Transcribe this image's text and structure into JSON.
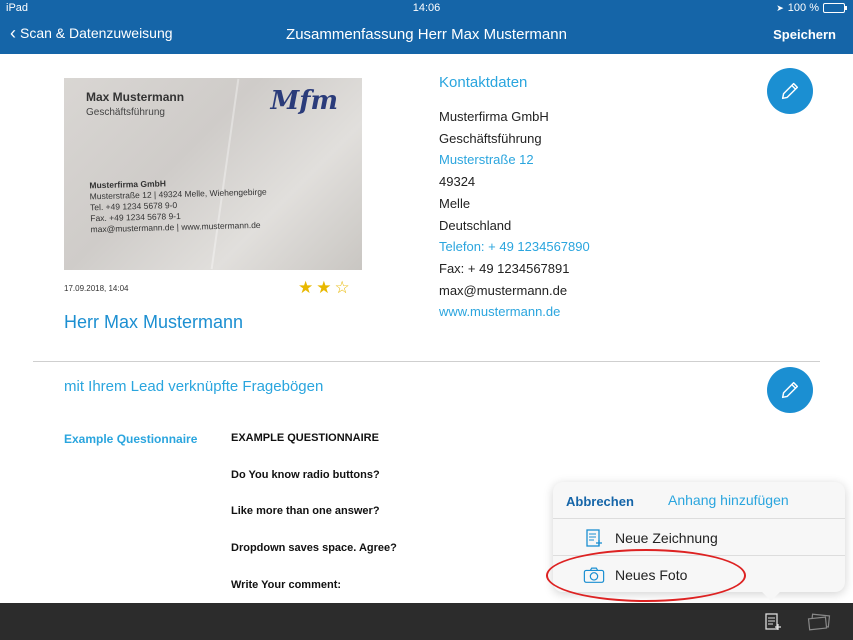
{
  "status": {
    "device": "iPad",
    "time": "14:06",
    "battery": "100 %"
  },
  "nav": {
    "back_label": "Scan & Datenzuweisung",
    "title": "Zusammenfassung Herr Max Mustermann",
    "save_label": "Speichern"
  },
  "card": {
    "name": "Max Mustermann",
    "role": "Geschäftsführung",
    "logo": "Mfm",
    "company": "Musterfirma GmbH",
    "address": "Musterstraße 12 | 49324 Melle, Wiehengebirge",
    "tel": "Tel. +49 1234 5678 9-0",
    "fax": "Fax. +49 1234 5678 9-1",
    "web": "max@mustermann.de | www.mustermann.de"
  },
  "lead": {
    "timestamp": "17.09.2018, 14:04",
    "rating": 2,
    "rating_max": 3,
    "name": "Herr Max Mustermann"
  },
  "contact": {
    "title": "Kontaktdaten",
    "company": "Musterfirma GmbH",
    "role": "Geschäftsführung",
    "street": "Musterstraße 12",
    "zip": "49324",
    "city": "Melle",
    "country": "Deutschland",
    "phone": "Telefon: + 49 1234567890",
    "fax": "Fax: + 49 1234567891",
    "email": "max@mustermann.de",
    "website": "www.mustermann.de"
  },
  "questionnaires": {
    "title": "mit Ihrem Lead verknüpfte Fragebögen",
    "name": "Example Questionnaire",
    "items": [
      "EXAMPLE QUESTIONNAIRE",
      "Do You know radio buttons?",
      "Like more than one answer?",
      "Dropdown saves space. Agree?",
      "Write Your comment:"
    ]
  },
  "popover": {
    "cancel_label": "Abbrechen",
    "title": "Anhang hinzufügen",
    "options": [
      {
        "label": "Neue Zeichnung",
        "icon": "drawing-icon"
      },
      {
        "label": "Neues Foto",
        "icon": "camera-icon"
      }
    ]
  },
  "colors": {
    "nav_bg": "#1565a8",
    "accent": "#2aa5de",
    "button": "#1b8fd2",
    "highlight": "#dd2222"
  }
}
